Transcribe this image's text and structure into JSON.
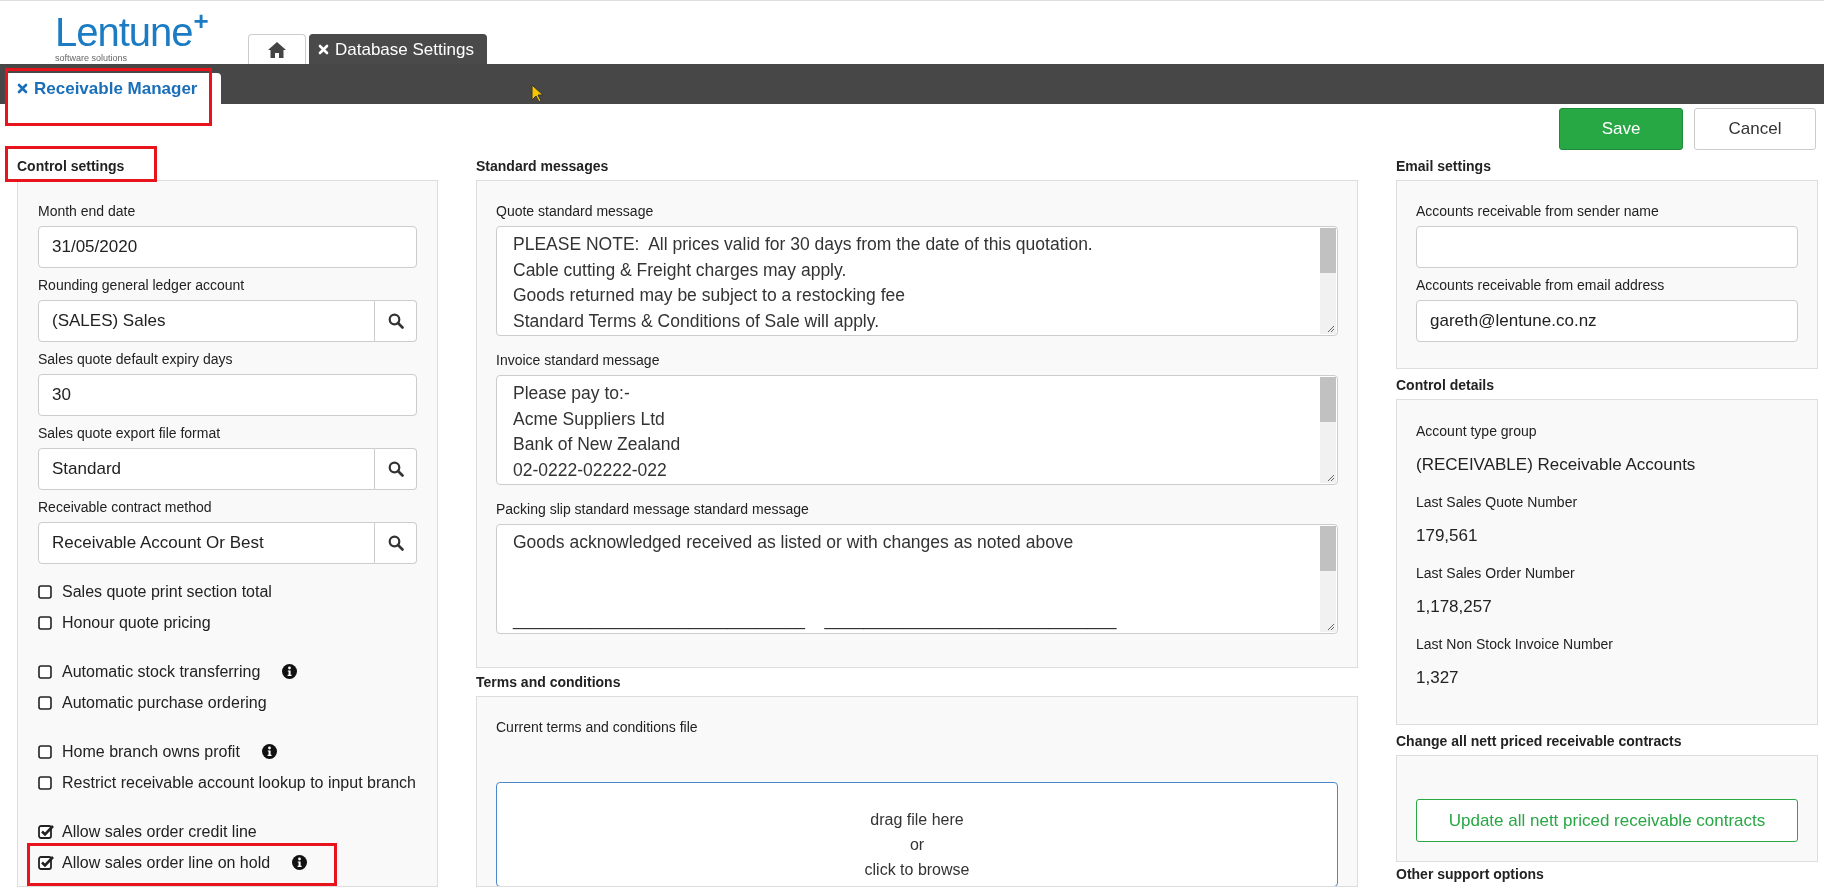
{
  "logo": {
    "name": "Lentune",
    "mark": "+",
    "tagline": "software solutions"
  },
  "top_tabs": [
    {
      "kind": "home",
      "selected": false
    },
    {
      "kind": "page",
      "label": "Database Settings",
      "selected": true
    }
  ],
  "sub_tabs": [
    {
      "label": "Receivable Manager",
      "selected": true,
      "highlighted": true
    }
  ],
  "actions": [
    {
      "kind": "primary",
      "label": "Save"
    },
    {
      "kind": "secondary",
      "label": "Cancel"
    }
  ],
  "control_settings": {
    "title": "Control settings",
    "highlighted": true,
    "fields": [
      {
        "label": "Month end date",
        "value": "31/05/2020",
        "lookup": false
      },
      {
        "label": "Rounding general ledger account",
        "value": "(SALES) Sales",
        "lookup": true
      },
      {
        "label": "Sales quote default expiry days",
        "value": "30",
        "lookup": false
      },
      {
        "label": "Sales quote export file format",
        "value": "Standard",
        "lookup": true
      },
      {
        "label": "Receivable contract method",
        "value": "Receivable Account Or Best",
        "lookup": true
      }
    ],
    "checkbox_groups": [
      [
        {
          "label": "Sales quote print section total",
          "checked": false,
          "info": false,
          "highlighted": false
        },
        {
          "label": "Honour quote pricing",
          "checked": false,
          "info": false,
          "highlighted": false
        }
      ],
      [
        {
          "label": "Automatic stock transferring",
          "checked": false,
          "info": true,
          "highlighted": false
        },
        {
          "label": "Automatic purchase ordering",
          "checked": false,
          "info": false,
          "highlighted": false
        }
      ],
      [
        {
          "label": "Home branch owns profit",
          "checked": false,
          "info": true,
          "highlighted": false
        },
        {
          "label": "Restrict receivable account lookup to input branch",
          "checked": false,
          "info": false,
          "highlighted": false
        }
      ],
      [
        {
          "label": "Allow sales order credit line",
          "checked": true,
          "info": false,
          "highlighted": false
        },
        {
          "label": "Allow sales order line on hold",
          "checked": true,
          "info": true,
          "highlighted": true
        }
      ]
    ]
  },
  "standard_messages": {
    "title": "Standard messages",
    "messages": [
      {
        "label": "Quote standard message",
        "text": "PLEASE NOTE:  All prices valid for 30 days from the date of this quotation.\nCable cutting & Freight charges may apply.\nGoods returned may be subject to a restocking fee\nStandard Terms & Conditions of Sale will apply."
      },
      {
        "label": "Invoice standard message",
        "text": "Please pay to:-\nAcme Suppliers Ltd\nBank of New Zealand\n02-0222-02222-022"
      },
      {
        "label": "Packing slip standard message standard message",
        "text": "Goods acknowledged received as listed or with changes as noted above\n\n\n______________________________    ______________________________"
      }
    ]
  },
  "terms": {
    "title": "Terms and conditions",
    "file_label": "Current terms and conditions file",
    "dropzone_lines": [
      "drag file here",
      "or",
      "click to browse"
    ]
  },
  "email_settings": {
    "title": "Email settings",
    "fields": [
      {
        "label": "Accounts receivable from sender name"
      },
      {
        "label": "Accounts receivable from email address",
        "value": "gareth@lentune.co.nz"
      }
    ]
  },
  "control_details": {
    "title": "Control details",
    "items": [
      {
        "label": "Account type group",
        "value": "(RECEIVABLE) Receivable Accounts"
      },
      {
        "label": "Last Sales Quote Number",
        "value": "179,561"
      },
      {
        "label": "Last Sales Order Number",
        "value": "1,178,257"
      },
      {
        "label": "Last Non Stock Invoice Number",
        "value": "1,327"
      }
    ]
  },
  "nett_contracts": {
    "title": "Change all nett priced receivable contracts",
    "button": "Update all nett priced receivable contracts"
  },
  "other_support": {
    "title": "Other support options"
  }
}
